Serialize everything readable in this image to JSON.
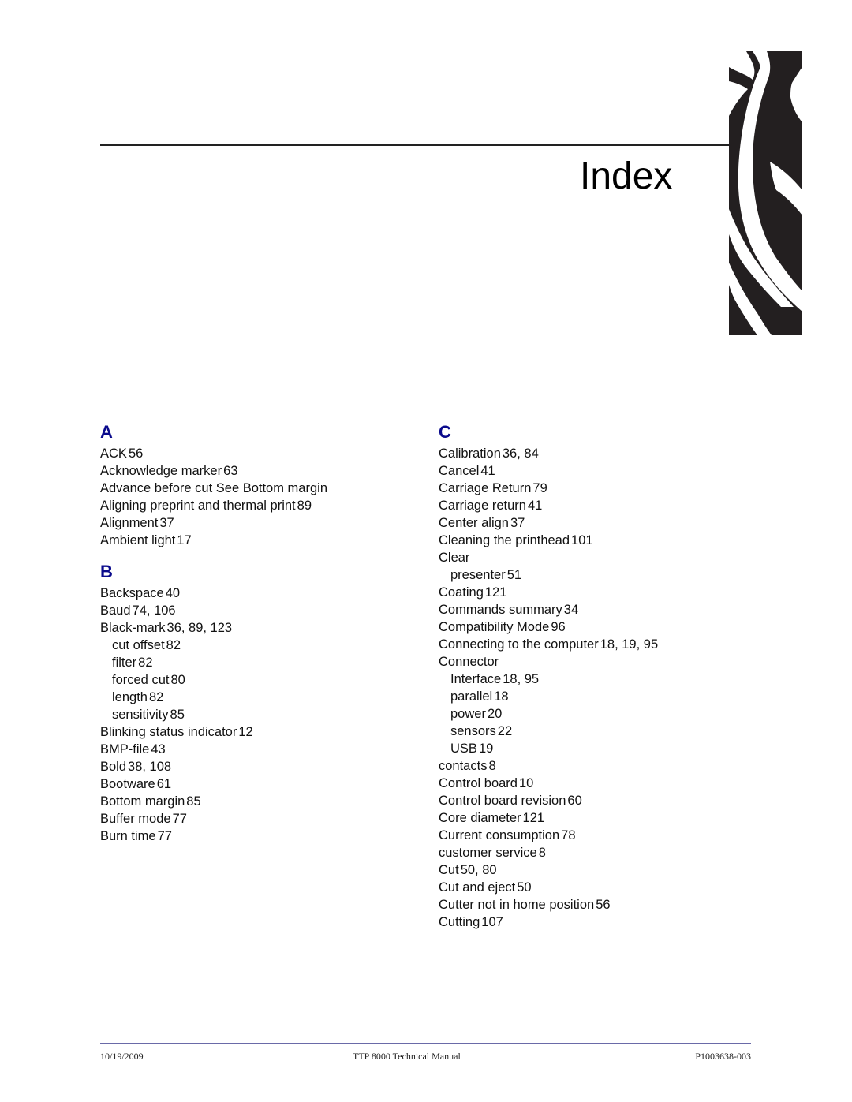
{
  "page": {
    "title": "Index"
  },
  "sections": [
    {
      "letter": "A",
      "entries": [
        {
          "term": "ACK",
          "pages": "56",
          "sub": false
        },
        {
          "term": "Acknowledge marker",
          "pages": "63",
          "sub": false
        },
        {
          "term": "Advance before cut See Bottom margin",
          "pages": "",
          "sub": false
        },
        {
          "term": "Aligning preprint and thermal print",
          "pages": "89",
          "sub": false
        },
        {
          "term": "Alignment",
          "pages": "37",
          "sub": false
        },
        {
          "term": "Ambient light",
          "pages": "17",
          "sub": false
        }
      ]
    },
    {
      "letter": "B",
      "entries": [
        {
          "term": "Backspace",
          "pages": "40",
          "sub": false
        },
        {
          "term": "Baud",
          "pages": "74, 106",
          "sub": false
        },
        {
          "term": "Black-mark",
          "pages": "36, 89, 123",
          "sub": false
        },
        {
          "term": "cut offset",
          "pages": "82",
          "sub": true
        },
        {
          "term": "filter",
          "pages": "82",
          "sub": true
        },
        {
          "term": "forced cut",
          "pages": "80",
          "sub": true
        },
        {
          "term": "length",
          "pages": "82",
          "sub": true
        },
        {
          "term": "sensitivity",
          "pages": "85",
          "sub": true
        },
        {
          "term": "Blinking status indicator",
          "pages": "12",
          "sub": false
        },
        {
          "term": "BMP-file",
          "pages": "43",
          "sub": false
        },
        {
          "term": "Bold",
          "pages": "38, 108",
          "sub": false
        },
        {
          "term": "Bootware",
          "pages": "61",
          "sub": false
        },
        {
          "term": "Bottom margin",
          "pages": "85",
          "sub": false
        },
        {
          "term": "Buffer mode",
          "pages": "77",
          "sub": false
        },
        {
          "term": "Burn time",
          "pages": "77",
          "sub": false
        }
      ]
    },
    {
      "letter": "C",
      "entries": [
        {
          "term": "Calibration",
          "pages": "36, 84",
          "sub": false
        },
        {
          "term": "Cancel",
          "pages": "41",
          "sub": false
        },
        {
          "term": "Carriage Return",
          "pages": "79",
          "sub": false
        },
        {
          "term": "Carriage return",
          "pages": "41",
          "sub": false
        },
        {
          "term": "Center align",
          "pages": "37",
          "sub": false
        },
        {
          "term": "Cleaning the printhead",
          "pages": "101",
          "sub": false
        },
        {
          "term": "Clear",
          "pages": "",
          "sub": false
        },
        {
          "term": "presenter",
          "pages": "51",
          "sub": true
        },
        {
          "term": "Coating",
          "pages": "121",
          "sub": false
        },
        {
          "term": "Commands summary",
          "pages": "34",
          "sub": false
        },
        {
          "term": "Compatibility Mode",
          "pages": "96",
          "sub": false
        },
        {
          "term": "Connecting to the computer",
          "pages": "18, 19, 95",
          "sub": false
        },
        {
          "term": "Connector",
          "pages": "",
          "sub": false
        },
        {
          "term": "Interface",
          "pages": "18, 95",
          "sub": true
        },
        {
          "term": "parallel",
          "pages": "18",
          "sub": true
        },
        {
          "term": "power",
          "pages": "20",
          "sub": true
        },
        {
          "term": "sensors",
          "pages": "22",
          "sub": true
        },
        {
          "term": "USB",
          "pages": "19",
          "sub": true
        },
        {
          "term": "contacts",
          "pages": "8",
          "sub": false
        },
        {
          "term": "Control board",
          "pages": "10",
          "sub": false
        },
        {
          "term": "Control board revision",
          "pages": "60",
          "sub": false
        },
        {
          "term": "Core diameter",
          "pages": "121",
          "sub": false
        },
        {
          "term": "Current consumption",
          "pages": "78",
          "sub": false
        },
        {
          "term": "customer service",
          "pages": "8",
          "sub": false
        },
        {
          "term": "Cut",
          "pages": "50, 80",
          "sub": false
        },
        {
          "term": "Cut and eject",
          "pages": "50",
          "sub": false
        },
        {
          "term": "Cutter not in home position",
          "pages": "56",
          "sub": false
        },
        {
          "term": "Cutting",
          "pages": "107",
          "sub": false
        }
      ]
    }
  ],
  "footer": {
    "date": "10/19/2009",
    "manual": "TTP 8000 Technical Manual",
    "part_number": "P1003638-003"
  },
  "colors": {
    "section_letter": "#0a0a8c",
    "footer_rule": "#6a6aa8"
  }
}
